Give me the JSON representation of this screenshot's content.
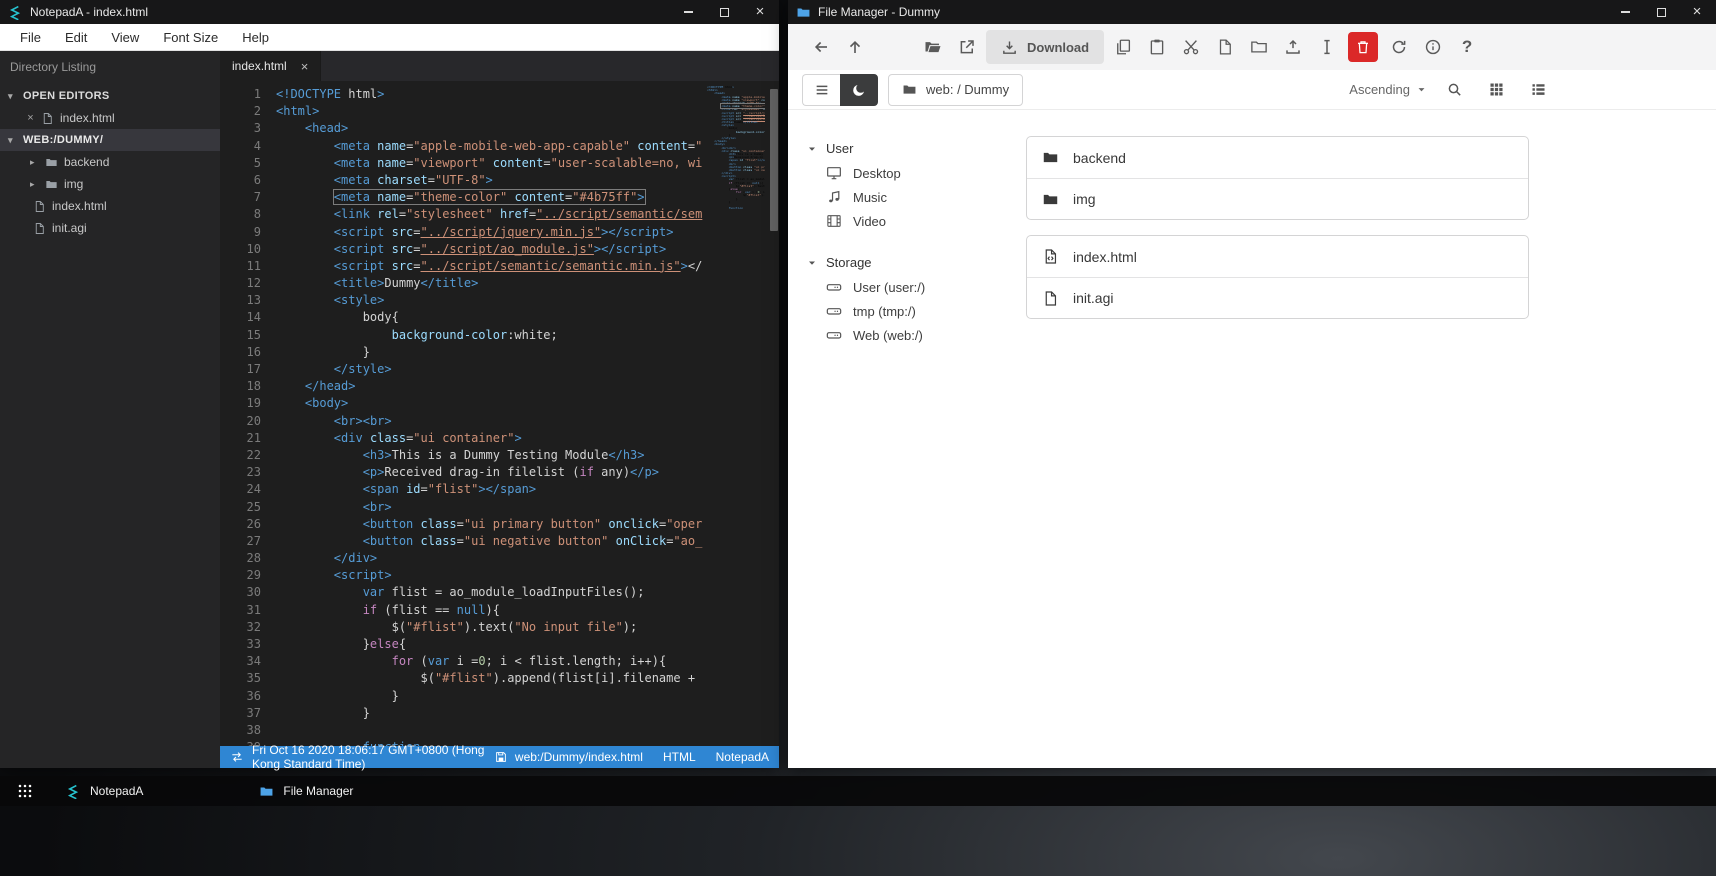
{
  "desktop": {
    "taskbar": {
      "apps": [
        "NotepadA",
        "File Manager"
      ]
    }
  },
  "notepad": {
    "title": "NotepadA - index.html",
    "menu": [
      "File",
      "Edit",
      "View",
      "Font Size",
      "Help"
    ],
    "sidebar": {
      "header": "Directory Listing",
      "open_editors_label": "OPEN EDITORS",
      "open_editor_file": "index.html",
      "workspace_label": "WEB:/DUMMY/",
      "entries": [
        {
          "name": "backend",
          "type": "folder"
        },
        {
          "name": "img",
          "type": "folder"
        },
        {
          "name": "index.html",
          "type": "file"
        },
        {
          "name": "init.agi",
          "type": "file"
        }
      ]
    },
    "tab": "index.html",
    "editor": {
      "active_line": 7,
      "lines": [
        "<!DOCTYPE html>",
        "<html>",
        "    <head>",
        "        <meta name=\"apple-mobile-web-app-capable\" content=\"",
        "        <meta name=\"viewport\" content=\"user-scalable=no, wi",
        "        <meta charset=\"UTF-8\">",
        "        <meta name=\"theme-color\" content=\"#4b75ff\">",
        "        <link rel=\"stylesheet\" href=\"../script/semantic/sem",
        "        <script src=\"../script/jquery.min.js\"></script>",
        "        <script src=\"../script/ao_module.js\"></script>",
        "        <script src=\"../script/semantic/semantic.min.js\"></",
        "        <title>Dummy</title>",
        "        <style>",
        "            body{",
        "                background-color:white;",
        "            }",
        "        </style>",
        "    </head>",
        "    <body>",
        "        <br><br>",
        "        <div class=\"ui container\">",
        "            <h3>This is a Dummy Testing Module</h3>",
        "            <p>Received drag-in filelist (if any)</p>",
        "            <span id=\"flist\"></span>",
        "            <br>",
        "            <button class=\"ui primary button\" onclick=\"oper",
        "            <button class=\"ui negative button\" onClick=\"ao_",
        "        </div>",
        "        <script>",
        "            var flist = ao_module_loadInputFiles();",
        "            if (flist == null){",
        "                $(\"#flist\").text(\"No input file\");",
        "            }else{",
        "                for (var i =0; i < flist.length; i++){",
        "                    $(\"#flist\").append(flist[i].filename + ",
        "                }",
        "            }",
        "",
        "            function "
      ]
    },
    "statusbar": {
      "datetime": "Fri Oct 16 2020 18:06:17 GMT+0800 (Hong Kong Standard Time)",
      "file_path": "web:/Dummy/index.html",
      "language": "HTML",
      "app": "NotepadA"
    }
  },
  "filemanager": {
    "title": "File Manager - Dummy",
    "toolbar": {
      "download_label": "Download"
    },
    "pathbar": {
      "path": "web: / Dummy",
      "sort": "Ascending"
    },
    "sidebar": {
      "sections": [
        {
          "label": "User",
          "items": [
            {
              "icon": "desktop",
              "label": "Desktop"
            },
            {
              "icon": "music",
              "label": "Music"
            },
            {
              "icon": "film",
              "label": "Video"
            }
          ]
        },
        {
          "label": "Storage",
          "items": [
            {
              "icon": "hdd",
              "label": "User (user:/)"
            },
            {
              "icon": "hdd",
              "label": "tmp (tmp:/)"
            },
            {
              "icon": "hdd",
              "label": "Web (web:/)"
            }
          ]
        }
      ]
    },
    "groups": [
      {
        "items": [
          {
            "icon": "folder",
            "name": "backend"
          },
          {
            "icon": "folder",
            "name": "img"
          }
        ]
      },
      {
        "items": [
          {
            "icon": "file-code",
            "name": "index.html"
          },
          {
            "icon": "file",
            "name": "init.agi"
          }
        ]
      }
    ]
  }
}
